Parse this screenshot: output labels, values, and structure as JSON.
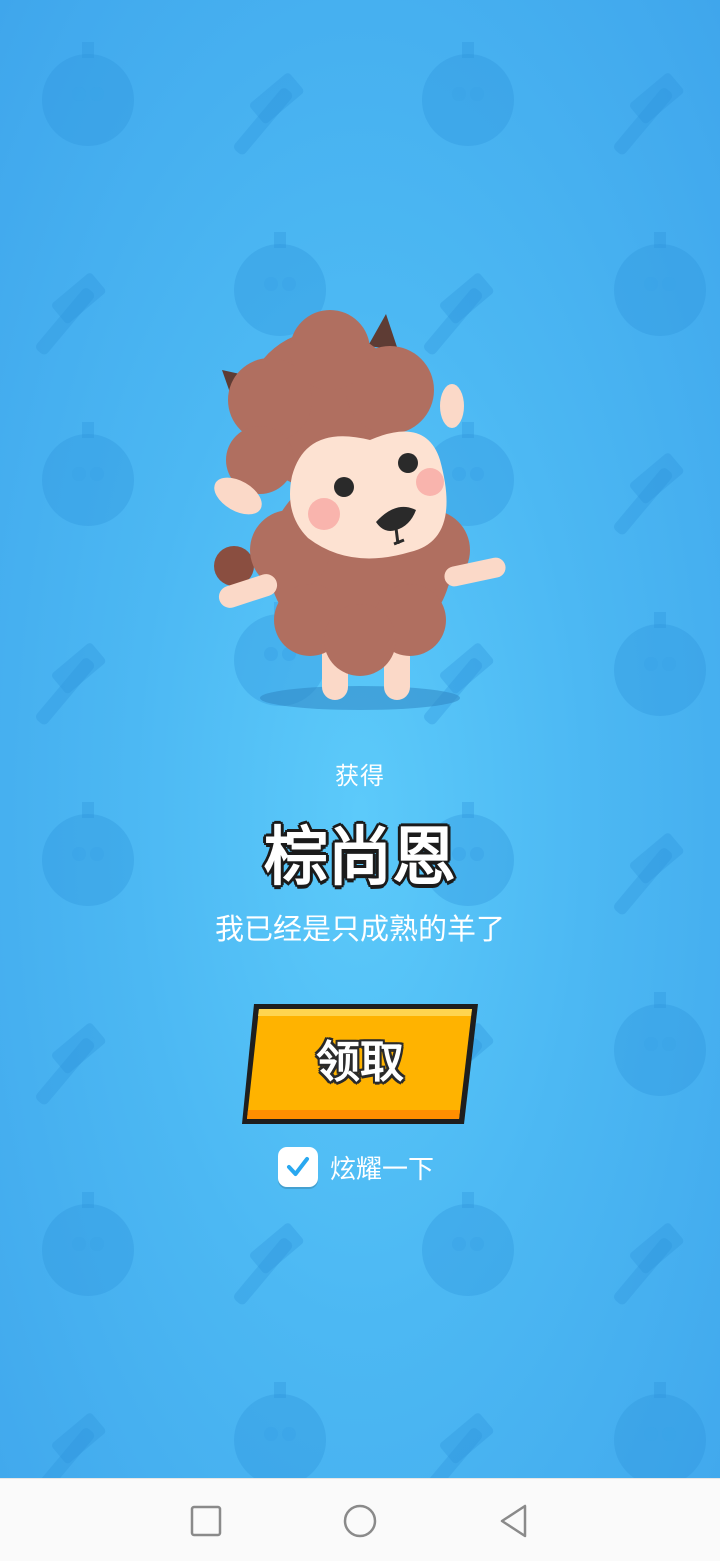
{
  "reward": {
    "obtain_label": "获得",
    "item_name": "棕尚恩",
    "description": "我已经是只成熟的羊了"
  },
  "actions": {
    "claim_label": "领取",
    "share_label": "炫耀一下",
    "share_checked": true
  },
  "navbar": {
    "recent_icon": "square-icon",
    "home_icon": "circle-icon",
    "back_icon": "triangle-back-icon"
  },
  "colors": {
    "background": "#4cb8f3",
    "button": "#ffb300",
    "check": "#29a8f0",
    "sheep_wool": "#b06f60"
  }
}
